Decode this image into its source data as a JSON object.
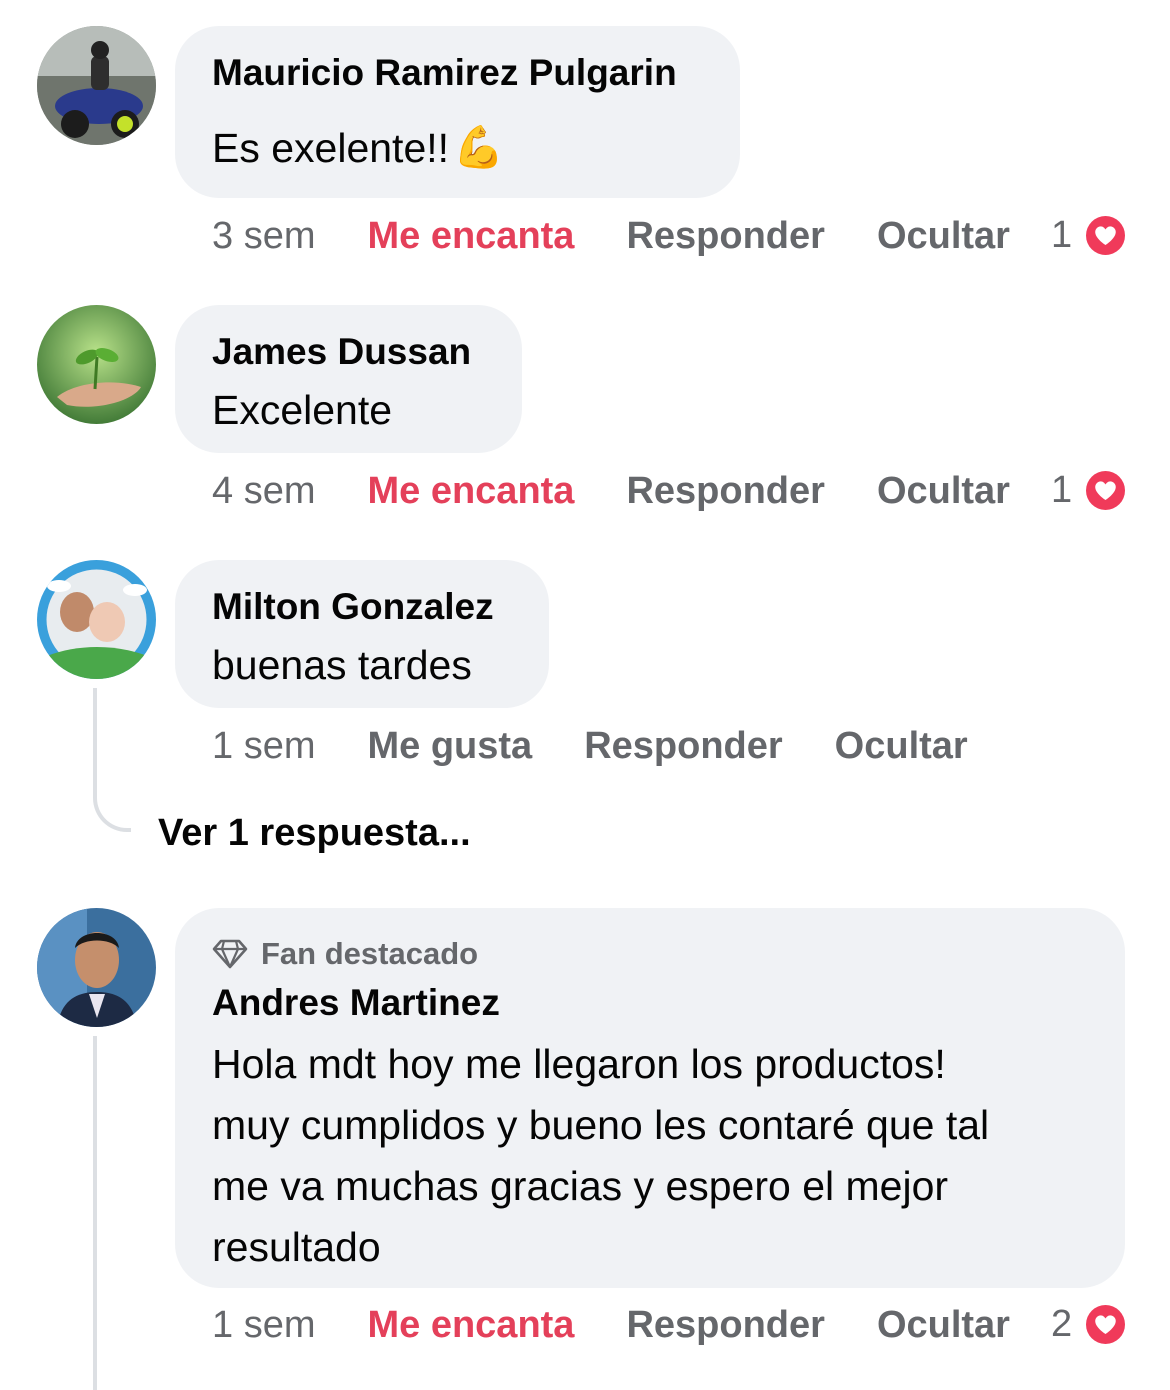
{
  "comments": [
    {
      "name": "Mauricio Ramirez Pulgarin",
      "text": "Es exelente!!",
      "emoji": "💪",
      "time": "3 sem",
      "like_label": "Me encanta",
      "reply_label": "Responder",
      "hide_label": "Ocultar",
      "reaction_count": "1"
    },
    {
      "name": "James Dussan",
      "text": "Excelente",
      "time": "4 sem",
      "like_label": "Me encanta",
      "reply_label": "Responder",
      "hide_label": "Ocultar",
      "reaction_count": "1"
    },
    {
      "name": "Milton Gonzalez",
      "text": "buenas tardes",
      "time": "1 sem",
      "like_label": "Me gusta",
      "reply_label": "Responder",
      "hide_label": "Ocultar",
      "view_replies": "Ver 1 respuesta..."
    },
    {
      "badge": "Fan destacado",
      "name": "Andres Martinez",
      "text_lines": [
        "Hola mdt hoy me llegaron los productos!",
        "muy cumplidos y bueno les contaré que tal",
        "me va muchas gracias y espero el mejor",
        "resultado"
      ],
      "time": "1 sem",
      "like_label": "Me encanta",
      "reply_label": "Responder",
      "hide_label": "Ocultar",
      "reaction_count": "2"
    }
  ],
  "colors": {
    "bubble": "#f0f2f5",
    "love": "#e4405a",
    "meta": "#65676b",
    "text": "#050505"
  },
  "icons": {
    "reaction": "heart-icon",
    "fan_badge": "diamond-icon"
  }
}
